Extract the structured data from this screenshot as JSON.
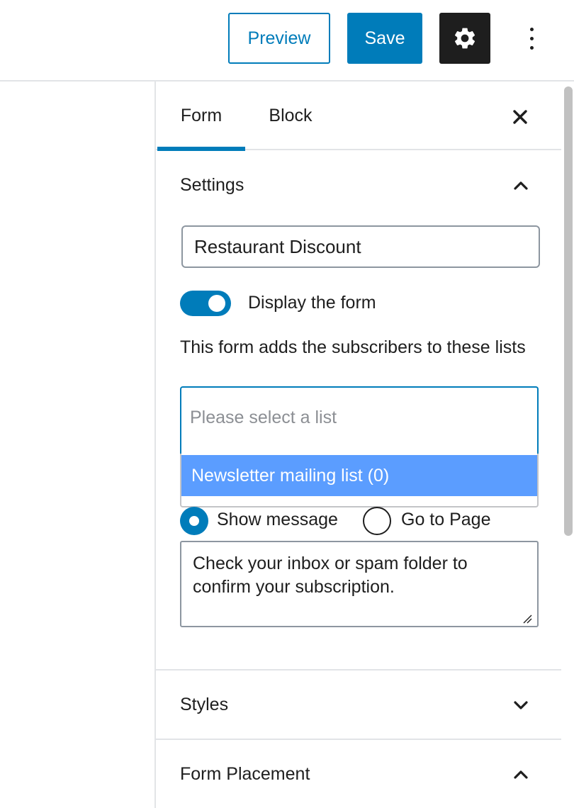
{
  "toolbar": {
    "preview_label": "Preview",
    "save_label": "Save",
    "settings_icon": "gear-icon",
    "more_icon": "vertical-ellipsis-icon"
  },
  "sidebar": {
    "tabs": [
      {
        "label": "Form",
        "active": true
      },
      {
        "label": "Block",
        "active": false
      }
    ],
    "close_icon": "close-icon",
    "settings_panel": {
      "title": "Settings",
      "expanded": true,
      "form_name": "Restaurant Discount",
      "display_toggle": {
        "label": "Display the form",
        "on": true
      },
      "lists_help": "This form adds the subscribers to these lists",
      "list_select": {
        "placeholder": "Please select a list",
        "options": [
          "Newsletter mailing list (0)"
        ]
      },
      "after_submit": {
        "options": [
          {
            "label": "Show message",
            "selected": true
          },
          {
            "label": "Go to Page",
            "selected": false
          }
        ],
        "message": "Check your inbox or spam folder to confirm your subscription."
      }
    },
    "styles_panel": {
      "title": "Styles",
      "expanded": false
    },
    "placement_panel": {
      "title": "Form Placement",
      "expanded": true
    }
  },
  "colors": {
    "accent": "#007cba",
    "dark": "#1e1e1e",
    "highlight": "#5b9dff",
    "border": "#e2e4e7"
  }
}
